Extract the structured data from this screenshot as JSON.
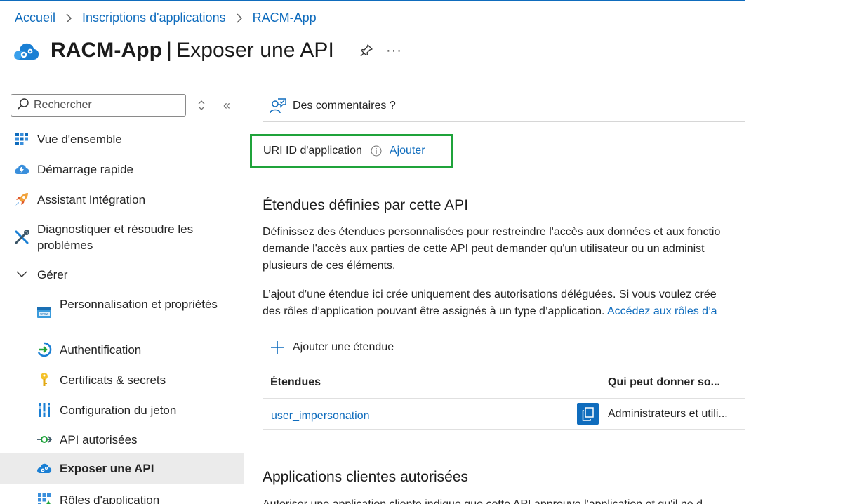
{
  "breadcrumb": {
    "items": [
      "Accueil",
      "Inscriptions d'applications",
      "RACM-App"
    ]
  },
  "header": {
    "app_name": "RACM-App",
    "separator": "|",
    "page_name": "Exposer une API",
    "more_label": "···"
  },
  "sidebar": {
    "search_placeholder": "Rechercher",
    "collapse_label": "«",
    "items": [
      {
        "label": "Vue d'ensemble",
        "icon": "overview-grid-icon"
      },
      {
        "label": "Démarrage rapide",
        "icon": "quickstart-cloud-icon"
      },
      {
        "label": "Assistant Intégration",
        "icon": "rocket-icon"
      },
      {
        "label": "Diagnostiquer et résoudre les problèmes",
        "icon": "wrench-tools-icon"
      },
      {
        "label": "Gérer",
        "icon": "chevron-down-icon"
      },
      {
        "label": "Personnalisation et propriétés",
        "icon": "branding-icon"
      },
      {
        "label": "Authentification",
        "icon": "authentication-icon"
      },
      {
        "label": "Certificats & secrets",
        "icon": "key-icon"
      },
      {
        "label": "Configuration du jeton",
        "icon": "token-bars-icon"
      },
      {
        "label": "API autorisées",
        "icon": "api-permissions-icon"
      },
      {
        "label": "Exposer une API",
        "icon": "expose-api-cloud-icon",
        "active": true
      },
      {
        "label": "Rôles d'application",
        "icon": "app-roles-icon"
      }
    ]
  },
  "main": {
    "feedback_label": "Des commentaires ?",
    "uri": {
      "label": "URI ID d'application",
      "action": "Ajouter"
    },
    "scopes_section": {
      "title": "Étendues définies par cette API",
      "paragraph1": [
        "Définissez des étendues personnalisées pour restreindre l'accès aux données et aux fonctio",
        "demande l'accès aux parties de cette API peut demander qu'un utilisateur ou un administ",
        "plusieurs de ces éléments."
      ],
      "paragraph2_line1": "L’ajout d’une étendue ici crée uniquement des autorisations déléguées. Si vous voulez crée",
      "paragraph2_line2": "des rôles d’application pouvant être assignés à un type d’application.",
      "paragraph2_link": "Accédez aux rôles d’a"
    },
    "add_scope_label": "Ajouter une étendue",
    "table": {
      "headers": [
        "Étendues",
        "Qui peut donner so..."
      ],
      "rows": [
        {
          "scope": "user_impersonation",
          "consent": "Administrateurs et utili..."
        }
      ]
    },
    "clients_section": {
      "title": "Applications clientes autorisées",
      "partial_text": "Autoriser une application cliente indique que cette API approuve l'application et qu'il ne d"
    }
  },
  "colors": {
    "accent": "#0f6cbd",
    "highlight_box": "#1fa33a",
    "active_item_bg": "#ebebeb"
  }
}
